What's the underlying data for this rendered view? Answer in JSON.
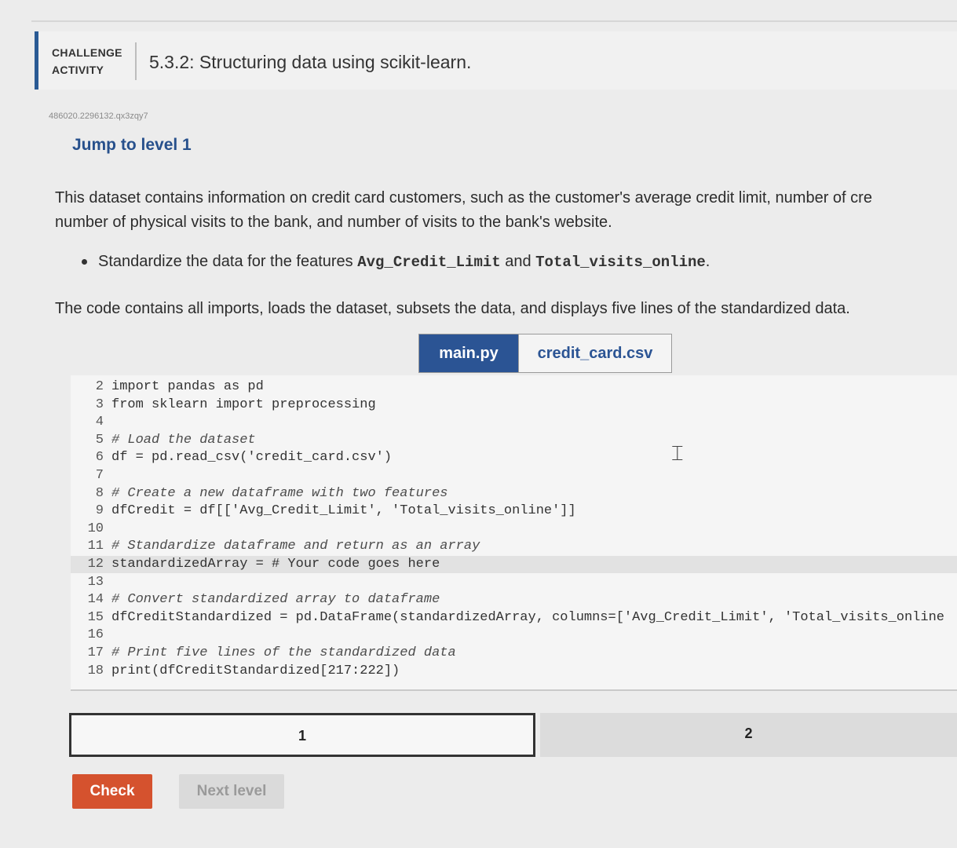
{
  "header": {
    "tag_line1": "CHALLENGE",
    "tag_line2": "ACTIVITY",
    "title": "5.3.2: Structuring data using scikit-learn."
  },
  "activity_id": "486020.2296132.qx3zqy7",
  "jump_link": "Jump to level 1",
  "instructions": {
    "para1_line1": "This dataset contains information on credit card customers, such as the customer's average credit limit, number of cre",
    "para1_line2": "number of physical visits to the bank, and number of visits to the bank's website.",
    "bullet_prefix": "Standardize the data for the features ",
    "bullet_code1": "Avg_Credit_Limit",
    "bullet_and": " and ",
    "bullet_code2": "Total_visits_online",
    "bullet_suffix": ".",
    "para2": "The code contains all imports, loads the dataset, subsets the data, and displays five lines of the standardized data."
  },
  "tabs": [
    {
      "label": "main.py",
      "active": true
    },
    {
      "label": "credit_card.csv",
      "active": false
    }
  ],
  "code": {
    "lines": [
      {
        "n": "2",
        "text": "import pandas as pd"
      },
      {
        "n": "3",
        "text": "from sklearn import preprocessing"
      },
      {
        "n": "4",
        "text": ""
      },
      {
        "n": "5",
        "text": "# Load the dataset"
      },
      {
        "n": "6",
        "text": "df = pd.read_csv('credit_card.csv')"
      },
      {
        "n": "7",
        "text": ""
      },
      {
        "n": "8",
        "text": "# Create a new dataframe with two features"
      },
      {
        "n": "9",
        "text": "dfCredit = df[['Avg_Credit_Limit', 'Total_visits_online']]"
      },
      {
        "n": "10",
        "text": ""
      },
      {
        "n": "11",
        "text": "# Standardize dataframe and return as an array"
      },
      {
        "n": "12",
        "text": "standardizedArray = # Your code goes here"
      },
      {
        "n": "13",
        "text": ""
      },
      {
        "n": "14",
        "text": "# Convert standardized array to dataframe"
      },
      {
        "n": "15",
        "text": "dfCreditStandardized = pd.DataFrame(standardizedArray, columns=['Avg_Credit_Limit', 'Total_visits_online"
      },
      {
        "n": "16",
        "text": ""
      },
      {
        "n": "17",
        "text": "# Print five lines of the standardized data"
      },
      {
        "n": "18",
        "text": "print(dfCreditStandardized[217:222])"
      }
    ]
  },
  "levels": [
    {
      "label": "1",
      "current": true
    },
    {
      "label": "2",
      "current": false
    }
  ],
  "buttons": {
    "check": "Check",
    "next": "Next level"
  },
  "colors": {
    "accent_blue": "#2b5494",
    "check_orange": "#d5522e"
  },
  "icons": {
    "text_cursor": "I-beam"
  }
}
